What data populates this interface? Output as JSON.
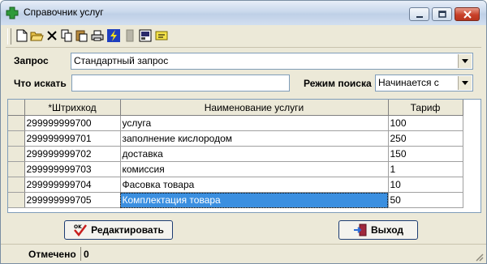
{
  "window": {
    "title": "Справочник услуг"
  },
  "toolbar": {
    "icons": [
      "new-document-icon",
      "open-folder-icon",
      "delete-icon",
      "copy-icon",
      "paste-icon",
      "print-icon",
      "lightning-icon",
      "disabled-icon",
      "export-icon",
      "note-icon"
    ]
  },
  "query": {
    "label": "Запрос",
    "value": "Стандартный запрос"
  },
  "search": {
    "label": "Что искать",
    "value": "",
    "mode_label": "Режим поиска",
    "mode_value": "Начинается с"
  },
  "table": {
    "columns": [
      "*Штрихкод",
      "Наименование услуги",
      "Тариф"
    ],
    "rows": [
      {
        "barcode": "299999999700",
        "name": "услуга",
        "tariff": "100"
      },
      {
        "barcode": "299999999701",
        "name": "заполнение кислородом",
        "tariff": "250"
      },
      {
        "barcode": "299999999702",
        "name": "доставка",
        "tariff": "150"
      },
      {
        "barcode": "299999999703",
        "name": "комиссия",
        "tariff": "1"
      },
      {
        "barcode": "299999999704",
        "name": "Фасовка товара",
        "tariff": "10"
      },
      {
        "barcode": "299999999705",
        "name": "Комплектация товара",
        "tariff": "50"
      }
    ],
    "selected_row": 5
  },
  "buttons": {
    "edit": "Редактировать",
    "exit": "Выход"
  },
  "status": {
    "label": "Отмечено",
    "count": "0"
  },
  "colors": {
    "selection": "#3b8fe0",
    "window_bg": "#ece9d8",
    "border": "#7f9db9"
  }
}
